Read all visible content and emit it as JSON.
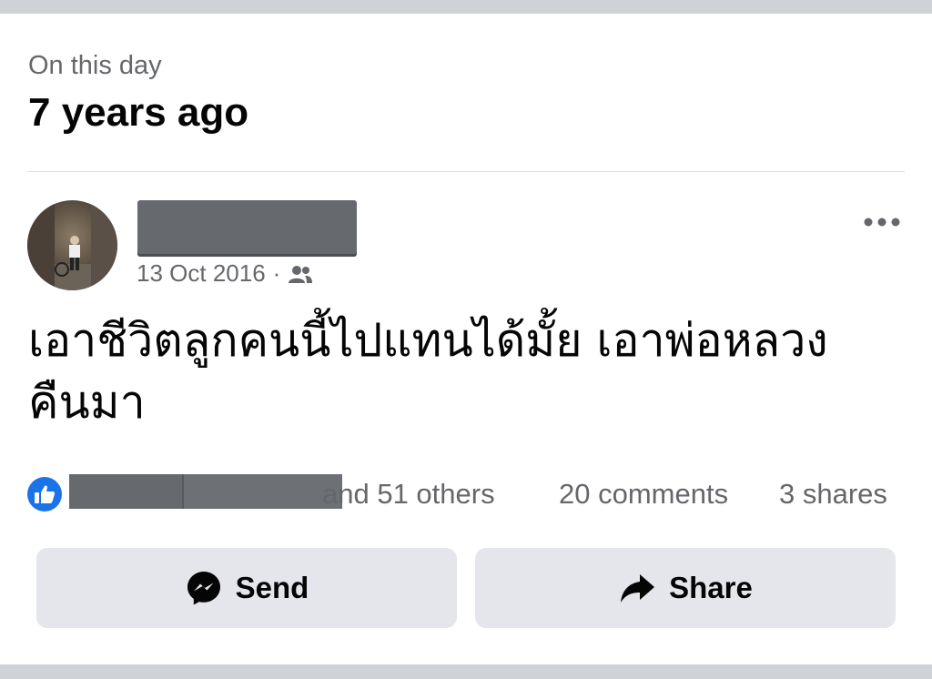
{
  "memory": {
    "label": "On this day",
    "title": "7 years ago"
  },
  "post": {
    "date": "13 Oct 2016",
    "separator": "·",
    "audience_icon": "friends-icon",
    "text_line1": "เอาชีวิตลูกคนนี้ไปแทนได้มั้ย  เอาพ่อหลวง",
    "text_line2": "คืนมา"
  },
  "reactions": {
    "others": "and 51 others",
    "comments": "20 comments",
    "shares": "3 shares"
  },
  "actions": {
    "send_label": "Send",
    "share_label": "Share"
  },
  "colors": {
    "like_blue": "#1a74e8",
    "secondary_text": "#65676b",
    "button_bg": "#e4e6eb"
  }
}
